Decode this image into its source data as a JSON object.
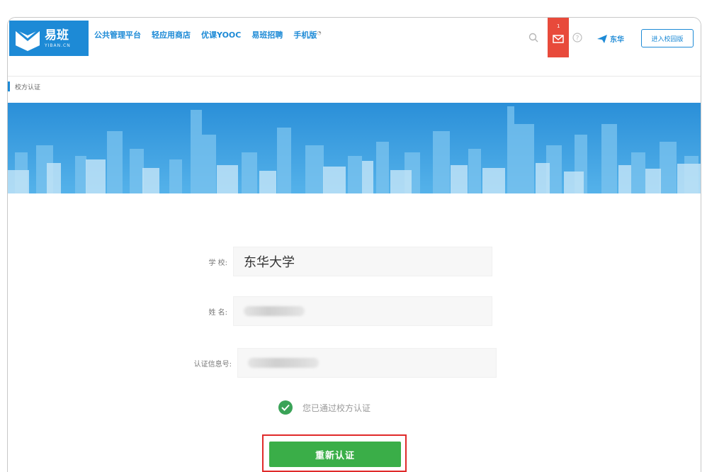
{
  "brand": {
    "name_cn": "易班",
    "name_en": "YIBAN.CN",
    "color": "#1d8ad6"
  },
  "nav": {
    "items": [
      {
        "label": "公共管理平台"
      },
      {
        "label": "轻应用商店"
      },
      {
        "label": "优课YOOC"
      },
      {
        "label": "易班招聘"
      },
      {
        "label": "手机版"
      }
    ]
  },
  "toolbar": {
    "search_icon": "search-icon",
    "mail_badge": "1",
    "mail_color": "#e84a3b",
    "help_icon": "help-icon",
    "user_label": "东华",
    "action_button": "进入校园版"
  },
  "breadcrumb": {
    "label": "校方认证"
  },
  "form": {
    "school_label": "学 校:",
    "school_value": "东华大学",
    "name_label": "姓 名:",
    "id_label": "认证信息号:",
    "verified_text": "您已通过校方认证",
    "reauth_button": "重新认证",
    "success_color": "#3aae48",
    "highlight_color": "#e02a2a"
  }
}
